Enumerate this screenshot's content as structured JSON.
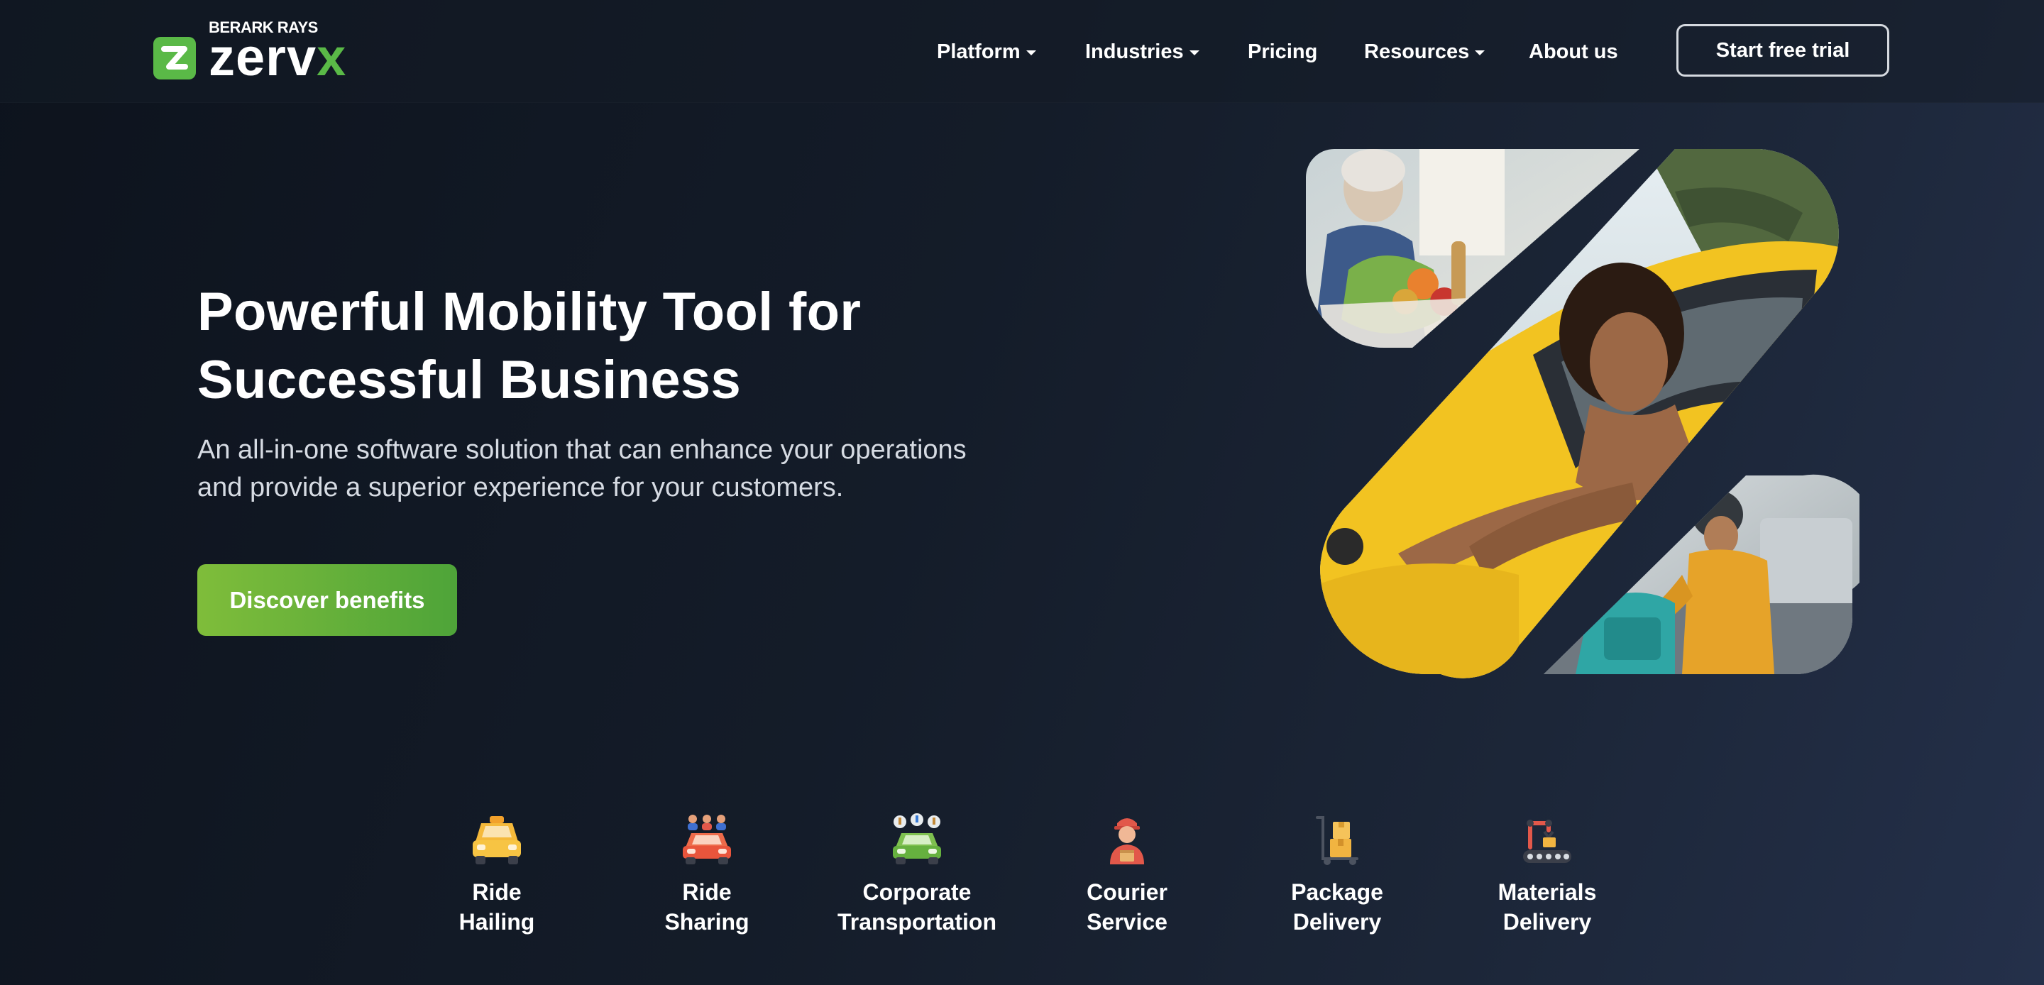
{
  "brand": {
    "super": "BERARK RAYS",
    "word": "zerv",
    "word_accent": "x",
    "accent_color": "#5ab947"
  },
  "nav": {
    "items": [
      {
        "label": "Platform",
        "has_dropdown": true
      },
      {
        "label": "Industries",
        "has_dropdown": true
      },
      {
        "label": "Pricing",
        "has_dropdown": false
      },
      {
        "label": "Resources",
        "has_dropdown": true
      },
      {
        "label": "About us",
        "has_dropdown": false
      }
    ],
    "trial_label": "Start free trial"
  },
  "hero": {
    "title_line1": "Powerful Mobility Tool for",
    "title_line2": "Successful Business",
    "subtitle_line1": "An all-in-one software solution that can enhance your operations",
    "subtitle_line2": "and provide a superior experience for your customers.",
    "cta_label": "Discover benefits",
    "cta_color": "#6bb13a"
  },
  "services": [
    {
      "label": "Ride\nHailing",
      "icon": "taxi-icon"
    },
    {
      "label": "Ride\nSharing",
      "icon": "ride-sharing-icon"
    },
    {
      "label": "Corporate\nTransportation",
      "icon": "corporate-transport-icon"
    },
    {
      "label": "Courier\nService",
      "icon": "courier-icon"
    },
    {
      "label": "Package\nDelivery",
      "icon": "package-icon"
    },
    {
      "label": "Materials\nDelivery",
      "icon": "materials-robot-icon"
    }
  ]
}
